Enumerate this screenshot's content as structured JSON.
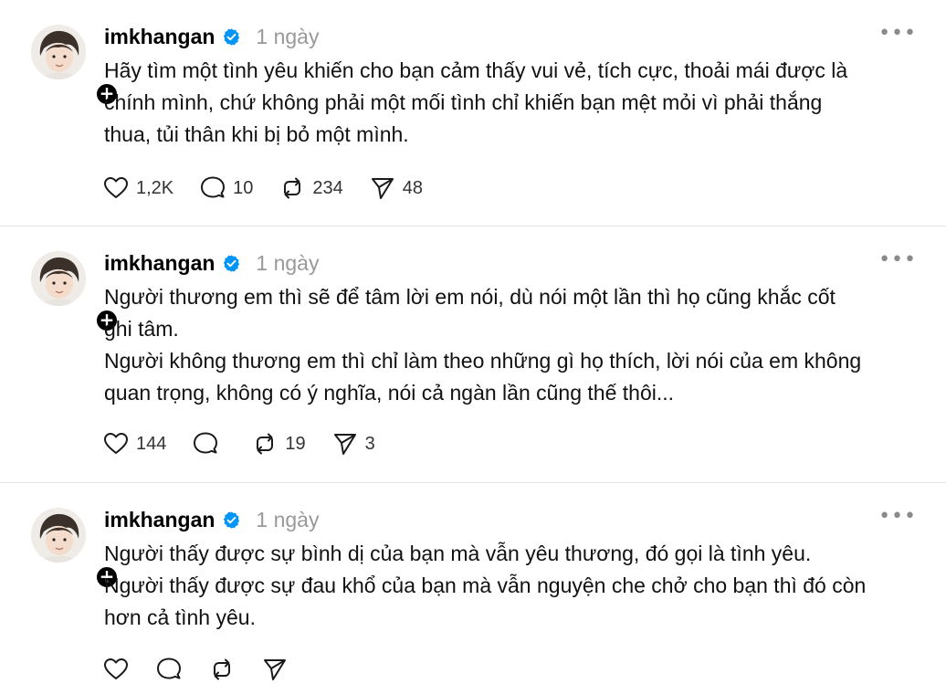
{
  "posts": [
    {
      "username": "imkhangan",
      "time": "1 ngày",
      "lines": [
        "Hãy tìm một tình yêu khiến cho bạn cảm thấy vui vẻ, tích cực, thoải mái được là",
        "chính mình, chứ không phải một mối tình chỉ khiến bạn mệt mỏi vì phải thắng",
        "thua, tủi thân khi bị bỏ một mình."
      ],
      "likes": "1,2K",
      "replies": "10",
      "reposts": "234",
      "shares": "48"
    },
    {
      "username": "imkhangan",
      "time": "1 ngày",
      "lines": [
        "Người thương em thì sẽ để tâm lời em nói, dù nói một lần thì họ cũng khắc cốt",
        "ghi tâm.",
        "Người không thương em thì chỉ làm theo những gì họ thích, lời nói của em không",
        "quan trọng, không có ý nghĩa, nói cả ngàn lần cũng thế thôi..."
      ],
      "likes": "144",
      "replies": "",
      "reposts": "19",
      "shares": "3"
    },
    {
      "username": "imkhangan",
      "time": "1 ngày",
      "lines": [
        "Người thấy được sự bình dị của bạn mà vẫn yêu thương, đó gọi là tình yêu.",
        "Người thấy được sự đau khổ của bạn mà vẫn nguyện che chở cho bạn thì đó còn",
        "hơn cả tình yêu."
      ]
    }
  ],
  "icons": {
    "like": "heart-icon",
    "reply": "comment-icon",
    "repost": "repost-icon",
    "share": "send-icon",
    "more": "more-icon",
    "verified": "verified-badge-icon",
    "follow": "plus-icon"
  },
  "colors": {
    "verified": "#0095f6",
    "muted": "#999999",
    "divider": "#e4e4e4"
  }
}
